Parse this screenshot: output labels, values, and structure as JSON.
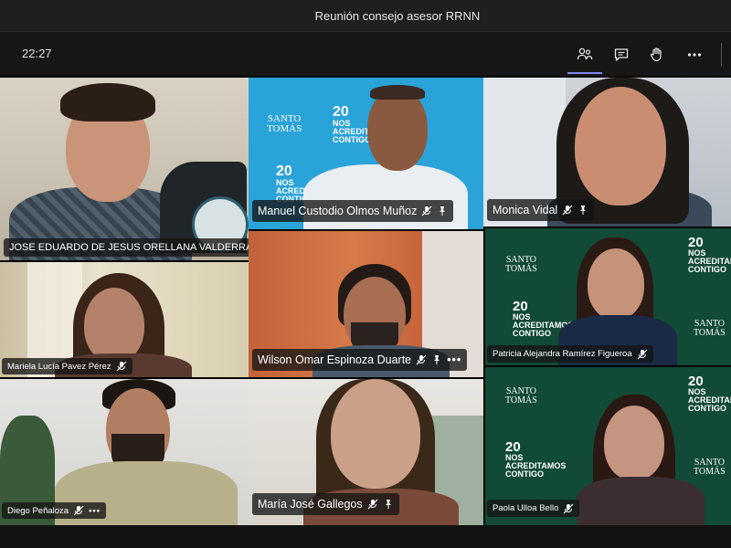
{
  "window": {
    "title": "Reunión consejo asesor RRNN"
  },
  "toolbar": {
    "time": "22:27",
    "buttons": [
      {
        "icon": "participants-icon"
      },
      {
        "icon": "chat-icon"
      },
      {
        "icon": "raise-hand-icon"
      },
      {
        "icon": "more-options-icon"
      }
    ]
  },
  "participants": [
    {
      "name": "JOSE EDUARDO DE JESUS ORELLANA VALDERRA...",
      "muted": true
    },
    {
      "name": "Manuel Custodio Olmos Muñoz",
      "muted": true,
      "pinned": true
    },
    {
      "name": "Monica Vidal",
      "muted": true,
      "pinned": true
    },
    {
      "name": "Mariela Lucía Pavez Pérez",
      "muted": true
    },
    {
      "name": "Wilson Omar Espinoza Duarte",
      "muted": true,
      "pinned": true,
      "more": "•••"
    },
    {
      "name": "Patricia Alejandra Ramírez Figueroa",
      "muted": true
    },
    {
      "name": "Diego Peñaloza",
      "muted": true,
      "more": "•••"
    },
    {
      "name": "María José Gallegos",
      "muted": true,
      "pinned": true
    },
    {
      "name": "Paola Ulloa Bello",
      "muted": true
    }
  ],
  "backdrop": {
    "brand_line1": "SANTO",
    "brand_line2": "TOMÁS",
    "badge_number": "20",
    "badge_text_1": "NOS",
    "badge_text_2": "ACREDITAMOS",
    "badge_text_3": "CONTIGO"
  }
}
